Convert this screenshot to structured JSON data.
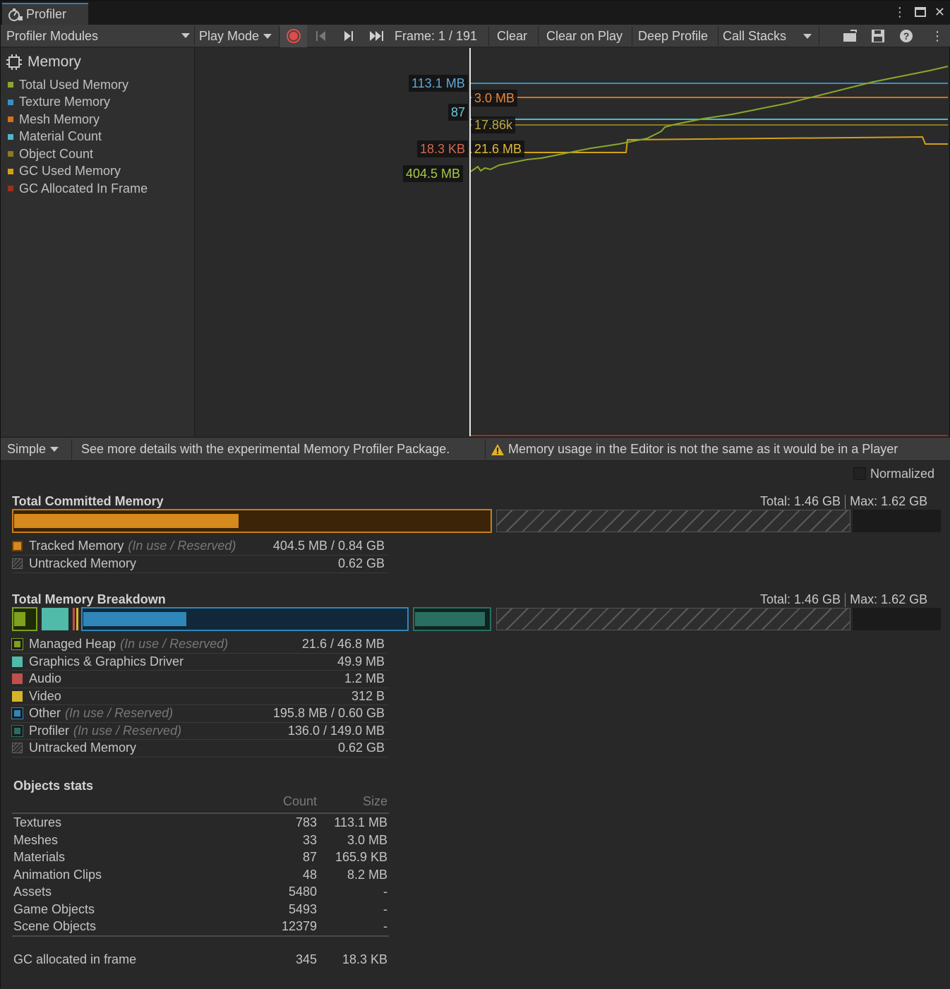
{
  "window": {
    "tab_title": "Profiler"
  },
  "toolbar": {
    "modules": "Profiler Modules",
    "play_mode": "Play Mode",
    "frame": "Frame: 1 / 191",
    "clear": "Clear",
    "clear_on_play": "Clear on Play",
    "deep_profile": "Deep Profile",
    "call_stacks": "Call Stacks"
  },
  "module": {
    "title": "Memory",
    "legend": [
      {
        "label": "Total Used Memory",
        "color": "#8aa82a"
      },
      {
        "label": "Texture Memory",
        "color": "#3a8ec2"
      },
      {
        "label": "Mesh Memory",
        "color": "#d2721c"
      },
      {
        "label": "Material Count",
        "color": "#4fb7c9"
      },
      {
        "label": "Object Count",
        "color": "#8a7a22"
      },
      {
        "label": "GC Used Memory",
        "color": "#d4a017"
      },
      {
        "label": "GC Allocated In Frame",
        "color": "#9a3020"
      }
    ]
  },
  "chart_labels": {
    "texture": "113.1 MB",
    "mesh": "3.0 MB",
    "material": "87",
    "object": "17.86k",
    "gc_alloc": "18.3 KB",
    "gc_used": "21.6 MB",
    "total": "404.5 MB"
  },
  "details": {
    "view": "Simple",
    "package_msg": "See more details with the experimental Memory Profiler Package.",
    "warning": "Memory usage in the Editor is not the same as it would be in a Player",
    "normalized": "Normalized"
  },
  "committed": {
    "title": "Total Committed Memory",
    "total": "Total: 1.46 GB",
    "max": "Max: 1.62 GB",
    "tracked_label": "Tracked Memory",
    "tracked_note": "(In use / Reserved)",
    "tracked_value": "404.5 MB / 0.84 GB",
    "untracked_label": "Untracked Memory",
    "untracked_value": "0.62 GB"
  },
  "breakdown": {
    "title": "Total Memory Breakdown",
    "total": "Total: 1.46 GB",
    "max": "Max: 1.62 GB",
    "rows": [
      {
        "label": "Managed Heap",
        "note": "(In use / Reserved)",
        "value": "21.6 / 46.8 MB",
        "color": "#7ea11e"
      },
      {
        "label": "Graphics & Graphics Driver",
        "note": "",
        "value": "49.9 MB",
        "color": "#4fbba8"
      },
      {
        "label": "Audio",
        "note": "",
        "value": "1.2 MB",
        "color": "#c0504d"
      },
      {
        "label": "Video",
        "note": "",
        "value": "312 B",
        "color": "#d4b52a"
      },
      {
        "label": "Other",
        "note": "(In use / Reserved)",
        "value": "195.8 MB / 0.60 GB",
        "color": "#2f86b8"
      },
      {
        "label": "Profiler",
        "note": "(In use / Reserved)",
        "value": "136.0 / 149.0 MB",
        "color": "#2a6e62"
      },
      {
        "label": "Untracked Memory",
        "note": "",
        "value": "0.62 GB",
        "color": "#555555"
      }
    ]
  },
  "objects": {
    "title": "Objects stats",
    "col_count": "Count",
    "col_size": "Size",
    "rows": [
      {
        "name": "Textures",
        "count": "783",
        "size": "113.1 MB"
      },
      {
        "name": "Meshes",
        "count": "33",
        "size": "3.0 MB"
      },
      {
        "name": "Materials",
        "count": "87",
        "size": "165.9 KB"
      },
      {
        "name": "Animation Clips",
        "count": "48",
        "size": "8.2 MB"
      },
      {
        "name": "Assets",
        "count": "5480",
        "size": "-"
      },
      {
        "name": "Game Objects",
        "count": "5493",
        "size": "-"
      },
      {
        "name": "Scene Objects",
        "count": "12379",
        "size": "-"
      }
    ],
    "gc": {
      "name": "GC allocated in frame",
      "count": "345",
      "size": "18.3 KB"
    }
  }
}
